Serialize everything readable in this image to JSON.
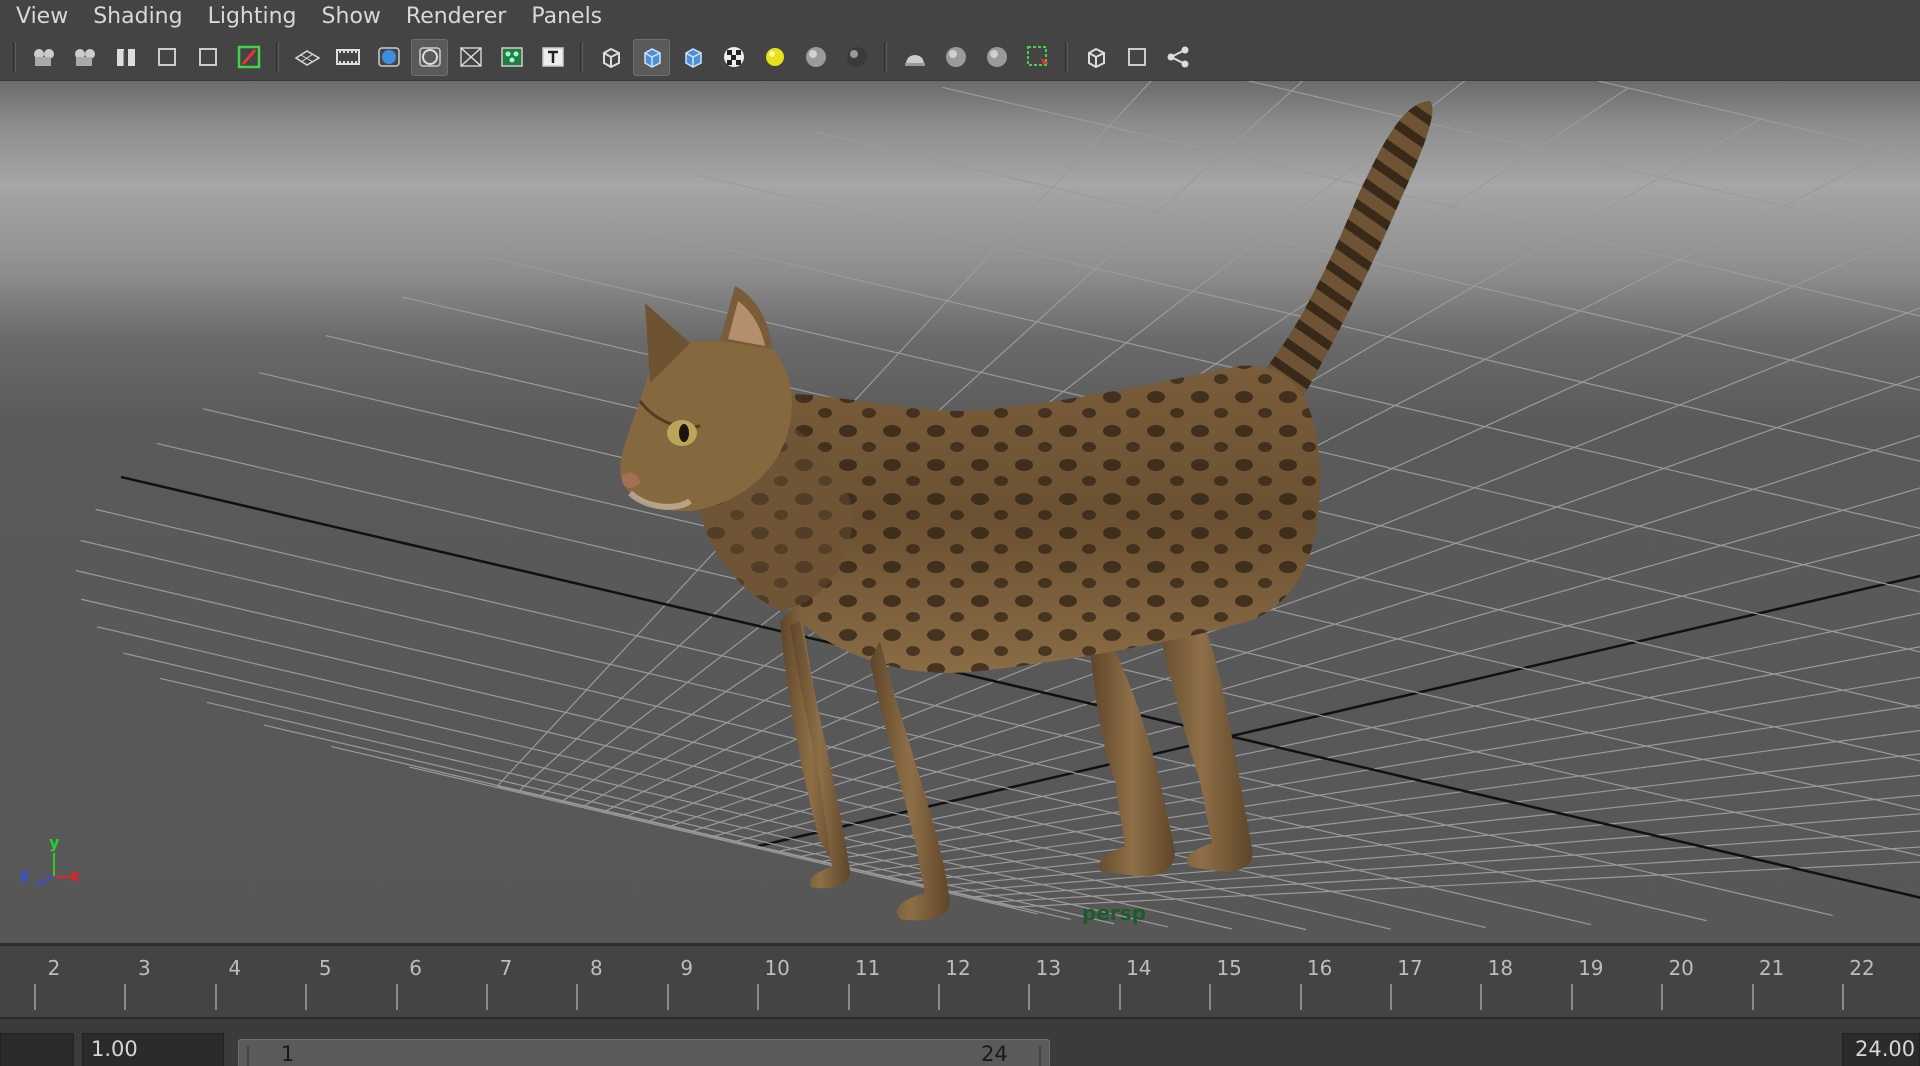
{
  "menu": [
    "View",
    "Shading",
    "Lighting",
    "Show",
    "Renderer",
    "Panels"
  ],
  "toolbar": {
    "groups": [
      [
        "select-camera-icon",
        "camera-attributes-icon",
        "bookmarks-icon",
        "image-plane-icon",
        "2d-pan-zoom-icon",
        "grease-pencil-icon"
      ],
      [
        "grid-icon",
        "film-gate-icon",
        "resolution-gate-icon",
        "gate-mask-icon",
        "field-chart-icon",
        "safe-action-icon",
        "safe-title-icon"
      ],
      [
        "wireframe-icon",
        "smooth-shade-icon",
        "default-material-icon",
        "textured-icon",
        "use-all-lights-icon",
        "shadows-icon",
        "screen-space-ao-icon"
      ],
      [
        "motion-blur-icon",
        "multisample-aa-icon",
        "depth-of-field-icon",
        "isolate-select-icon"
      ],
      [
        "xray-icon",
        "xray-active-components-icon",
        "xray-joints-icon"
      ]
    ],
    "active": [
      "smooth-shade-icon",
      "gate-mask-icon"
    ]
  },
  "viewport": {
    "camera_label": "persp",
    "axis": {
      "x": "x",
      "y": "y",
      "z": "z"
    },
    "colors": {
      "x": "#e0242a",
      "y": "#27d12b",
      "z": "#2f4fe8",
      "label": "#1d5c2a"
    }
  },
  "timeline": {
    "frames": [
      "2",
      "3",
      "4",
      "5",
      "6",
      "7",
      "8",
      "9",
      "10",
      "11",
      "12",
      "13",
      "14",
      "15",
      "16",
      "17",
      "18",
      "19",
      "20",
      "21",
      "22"
    ]
  },
  "range": {
    "start_time": "1.00",
    "range_start": "1",
    "range_end": "24",
    "end_time": "24.00"
  }
}
